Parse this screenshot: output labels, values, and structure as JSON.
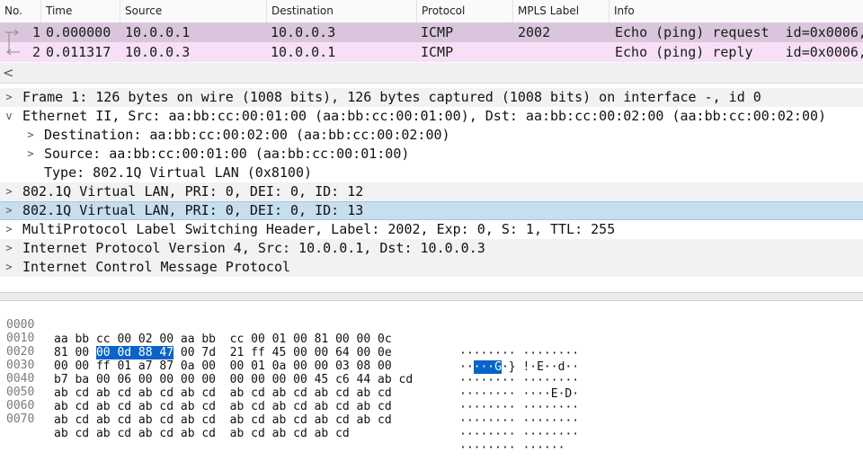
{
  "packet_list": {
    "columns": [
      "No.",
      "Time",
      "Source",
      "Destination",
      "Protocol",
      "MPLS Label",
      "Info"
    ],
    "rows": [
      {
        "no": "1",
        "time": "0.000000",
        "source": "10.0.0.1",
        "destination": "10.0.0.3",
        "protocol": "ICMP",
        "mpls": "2002",
        "info": "Echo (ping) request  id=0x0006,"
      },
      {
        "no": "2",
        "time": "0.011317",
        "source": "10.0.0.3",
        "destination": "10.0.0.1",
        "protocol": "ICMP",
        "mpls": "",
        "info": "Echo (ping) reply    id=0x0006,"
      }
    ]
  },
  "scrollbar": {
    "left_arrow": "<"
  },
  "details": [
    {
      "toggle": ">",
      "text": "Frame 1: 126 bytes on wire (1008 bits), 126 bytes captured (1008 bits) on interface -, id 0"
    },
    {
      "toggle": "v",
      "text": "Ethernet II, Src: aa:bb:cc:00:01:00 (aa:bb:cc:00:01:00), Dst: aa:bb:cc:00:02:00 (aa:bb:cc:00:02:00)"
    },
    {
      "toggle": ">",
      "text": "Destination: aa:bb:cc:00:02:00 (aa:bb:cc:00:02:00)"
    },
    {
      "toggle": ">",
      "text": "Source: aa:bb:cc:00:01:00 (aa:bb:cc:00:01:00)"
    },
    {
      "toggle": "",
      "text": "Type: 802.1Q Virtual LAN (0x8100)"
    },
    {
      "toggle": ">",
      "text": "802.1Q Virtual LAN, PRI: 0, DEI: 0, ID: 12"
    },
    {
      "toggle": ">",
      "text": "802.1Q Virtual LAN, PRI: 0, DEI: 0, ID: 13"
    },
    {
      "toggle": ">",
      "text": "MultiProtocol Label Switching Header, Label: 2002, Exp: 0, S: 1, TTL: 255"
    },
    {
      "toggle": ">",
      "text": "Internet Protocol Version 4, Src: 10.0.0.1, Dst: 10.0.0.3"
    },
    {
      "toggle": ">",
      "text": "Internet Control Message Protocol"
    }
  ],
  "bytes": [
    {
      "offset": "0000",
      "hex_a": "aa bb cc 00 02 00 aa bb",
      "hex_b": "cc 00 01 00 81 00 00 0c",
      "ascii_a": "········",
      "ascii_b": "········"
    },
    {
      "offset": "0010",
      "hex_pre": "81 00 ",
      "hex_hl": "00 0d 88 47",
      "hex_post": " 00 7d",
      "hex_b": "21 ff 45 00 00 64 00 0e",
      "ascii_pre": "··",
      "ascii_hl": "···G",
      "ascii_post": "·}",
      "ascii_b": "!·E··d··"
    },
    {
      "offset": "0020",
      "hex_a": "00 00 ff 01 a7 87 0a 00",
      "hex_b": "00 01 0a 00 00 03 08 00",
      "ascii_a": "········",
      "ascii_b": "········"
    },
    {
      "offset": "0030",
      "hex_a": "b7 ba 00 06 00 00 00 00",
      "hex_b": "00 00 00 00 45 c6 44 ab cd",
      "ascii_a": "········",
      "ascii_b": "····E·D·"
    },
    {
      "offset": "0040",
      "hex_a": "ab cd ab cd ab cd ab cd",
      "hex_b": "ab cd ab cd ab cd ab cd",
      "ascii_a": "········",
      "ascii_b": "········"
    },
    {
      "offset": "0050",
      "hex_a": "ab cd ab cd ab cd ab cd",
      "hex_b": "ab cd ab cd ab cd ab cd",
      "ascii_a": "········",
      "ascii_b": "········"
    },
    {
      "offset": "0060",
      "hex_a": "ab cd ab cd ab cd ab cd",
      "hex_b": "ab cd ab cd ab cd ab cd",
      "ascii_a": "········",
      "ascii_b": "········"
    },
    {
      "offset": "0070",
      "hex_a": "ab cd ab cd ab cd ab cd",
      "hex_b": "ab cd ab cd ab cd",
      "ascii_a": "········",
      "ascii_b": "······"
    }
  ]
}
